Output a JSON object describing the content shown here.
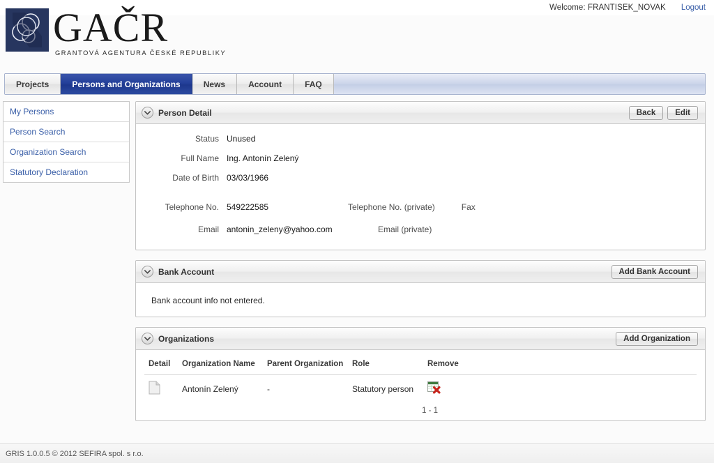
{
  "topbar": {
    "welcome": "Welcome: FRANTISEK_NOVAK",
    "logout": "Logout"
  },
  "logo": {
    "wordmark": "GAČR",
    "subtitle": "GRANTOVÁ AGENTURA ČESKÉ REPUBLIKY"
  },
  "tabs": [
    {
      "label": "Projects",
      "active": false
    },
    {
      "label": "Persons and Organizations",
      "active": true
    },
    {
      "label": "News",
      "active": false
    },
    {
      "label": "Account",
      "active": false
    },
    {
      "label": "FAQ",
      "active": false
    }
  ],
  "sidebar": {
    "items": [
      {
        "label": "My Persons"
      },
      {
        "label": "Person Search"
      },
      {
        "label": "Organization Search"
      },
      {
        "label": "Statutory Declaration"
      }
    ]
  },
  "person_detail": {
    "title": "Person Detail",
    "back_label": "Back",
    "edit_label": "Edit",
    "fields": {
      "status_label": "Status",
      "status_value": "Unused",
      "full_name_label": "Full Name",
      "full_name_value": "Ing. Antonín Zelený",
      "dob_label": "Date of Birth",
      "dob_value": "03/03/1966",
      "telephone_label": "Telephone No.",
      "telephone_value": "549222585",
      "telephone_private_label": "Telephone No. (private)",
      "telephone_private_value": "",
      "fax_label": "Fax",
      "fax_value": "",
      "email_label": "Email",
      "email_value": "antonin_zeleny@yahoo.com",
      "email_private_label": "Email (private)",
      "email_private_value": ""
    }
  },
  "bank_account": {
    "title": "Bank Account",
    "add_label": "Add Bank Account",
    "empty_message": "Bank account info not entered."
  },
  "organizations": {
    "title": "Organizations",
    "add_label": "Add Organization",
    "columns": [
      "Detail",
      "Organization Name",
      "Parent Organization",
      "Role",
      "Remove"
    ],
    "rows": [
      {
        "detail_icon": "document-icon",
        "organization_name": "Antonín Zelený",
        "parent_organization": "-",
        "role": "Statutory person",
        "remove_icon": "remove-table-icon"
      }
    ],
    "pager": "1 - 1"
  },
  "footer": {
    "text": "GRIS 1.0.0.5 © 2012 SEFIRA spol. s r.o."
  },
  "colors": {
    "active_tab": "#24409a",
    "link": "#3a5fa8",
    "panel_border": "#c4c4c4"
  }
}
